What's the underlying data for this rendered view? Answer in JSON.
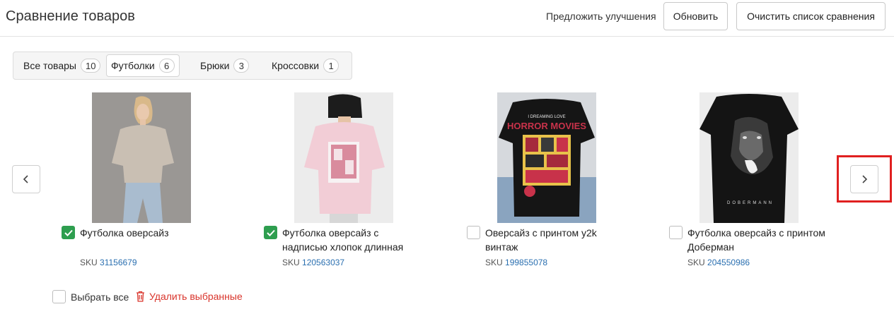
{
  "header": {
    "title": "Сравнение товаров",
    "suggest_link": "Предложить улучшения",
    "refresh_button": "Обновить",
    "clear_button": "Очистить список сравнения"
  },
  "tabs": [
    {
      "label": "Все товары",
      "count": "10",
      "active": false
    },
    {
      "label": "Футболки",
      "count": "6",
      "active": true
    },
    {
      "label": "Брюки",
      "count": "3",
      "active": false
    },
    {
      "label": "Кроссовки",
      "count": "1",
      "active": false
    }
  ],
  "products": [
    {
      "name": "Футболка оверсайз",
      "sku_label": "SKU",
      "sku": "31156679",
      "checked": true
    },
    {
      "name": "Футболка оверсайз с надписью хлопок длинная",
      "sku_label": "SKU",
      "sku": "120563037",
      "checked": true
    },
    {
      "name": "Оверсайз с принтом y2k винтаж",
      "sku_label": "SKU",
      "sku": "199855078",
      "checked": false
    },
    {
      "name": "Футболка оверсайз с принтом Доберман",
      "sku_label": "SKU",
      "sku": "204550986",
      "checked": false
    }
  ],
  "print_text": {
    "horror_top": "I DREAMING LOVE",
    "horror_main": "HORROR MOVIES",
    "doberman": "DOBERMANN"
  },
  "footer": {
    "select_all": "Выбрать все",
    "delete_selected": "Удалить выбранные"
  },
  "icons": {
    "prev": "chevron-left-icon",
    "next": "chevron-right-icon",
    "delete": "trash-icon",
    "check": "check-icon"
  },
  "colors": {
    "checked": "#2e9e4f",
    "link": "#2a6fb0",
    "danger": "#d9342b",
    "highlight": "#e02020"
  }
}
